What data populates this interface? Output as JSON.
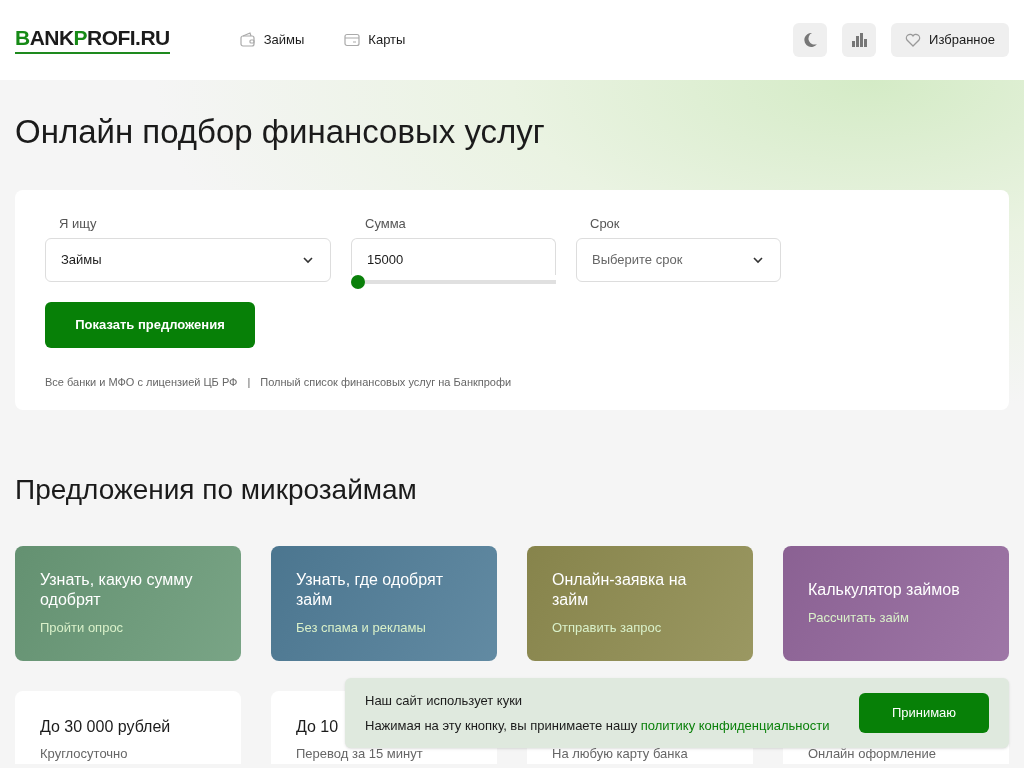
{
  "header": {
    "logo": {
      "first": "B",
      "mid": "ANK",
      "second": "P",
      "rest": "ROFI.RU"
    },
    "nav": [
      {
        "label": "Займы"
      },
      {
        "label": "Карты"
      }
    ],
    "favorites": "Избранное"
  },
  "title": "Онлайн подбор финансовых услуг",
  "search": {
    "fields": [
      {
        "kind": "select",
        "label": "Я ищу",
        "value": "Займы"
      },
      {
        "kind": "amount",
        "label": "Сумма",
        "value": "15000",
        "level": 0
      },
      {
        "kind": "select",
        "label": "Срок",
        "placeholder": "Выберите срок"
      }
    ],
    "button": "Показать предложения",
    "links": [
      "Все банки и МФО с лицензией ЦБ РФ",
      "|",
      "Полный список финансовых услуг на Банкпрофи"
    ]
  },
  "section_title": "Предложения по микрозаймам",
  "promo_cards": [
    {
      "title": "Узнать, какую сумму одобрят",
      "subtitle": "Пройти опрос",
      "color": "#6a9a78"
    },
    {
      "title": "Узнать, где одобрят займ",
      "subtitle": "Без спама и рекламы",
      "color": "#507d98"
    },
    {
      "title": "Онлайн-заявка на займ",
      "subtitle": "Отправить запрос",
      "color": "#8f8c50"
    },
    {
      "title": "Калькулятор займов",
      "subtitle": "Рассчитать займ",
      "color": "#93679c"
    }
  ],
  "offer_cards": [
    {
      "title": "До 30 000 рублей",
      "subtitle": "Круглосуточно"
    },
    {
      "title": "До 10",
      "subtitle": "Перевод за 15 минут"
    },
    {
      "subtitle": "На любую карту банка"
    },
    {
      "subtitle": "Онлайн оформление"
    }
  ],
  "cookie": {
    "title": "Наш сайт использует куки",
    "text": "Нажимая на эту кнопку, вы принимаете нашу",
    "link": "политику конфиденциальности",
    "button": "Принимаю"
  }
}
